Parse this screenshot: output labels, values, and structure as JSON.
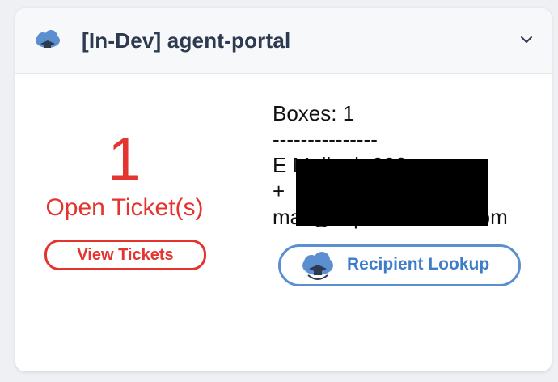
{
  "header": {
    "title": "[In-Dev] agent-portal",
    "icon": "cloud-graduate-icon",
    "collapse_icon": "chevron-down-icon"
  },
  "tickets": {
    "count": "1",
    "label": "Open Ticket(s)",
    "button_label": "View Tickets"
  },
  "info": {
    "boxes": "Boxes: 1",
    "divider": "---------------",
    "line_name": "E Mailnah 080",
    "line_phone": "+",
    "line_email": "mail@ccprocco-mail.com"
  },
  "lookup": {
    "button_label": "Recipient Lookup",
    "icon": "cloud-graduate-icon"
  },
  "colors": {
    "accent_red": "#e3342f",
    "accent_blue": "#3e7dc9",
    "title": "#2d3a4f"
  }
}
